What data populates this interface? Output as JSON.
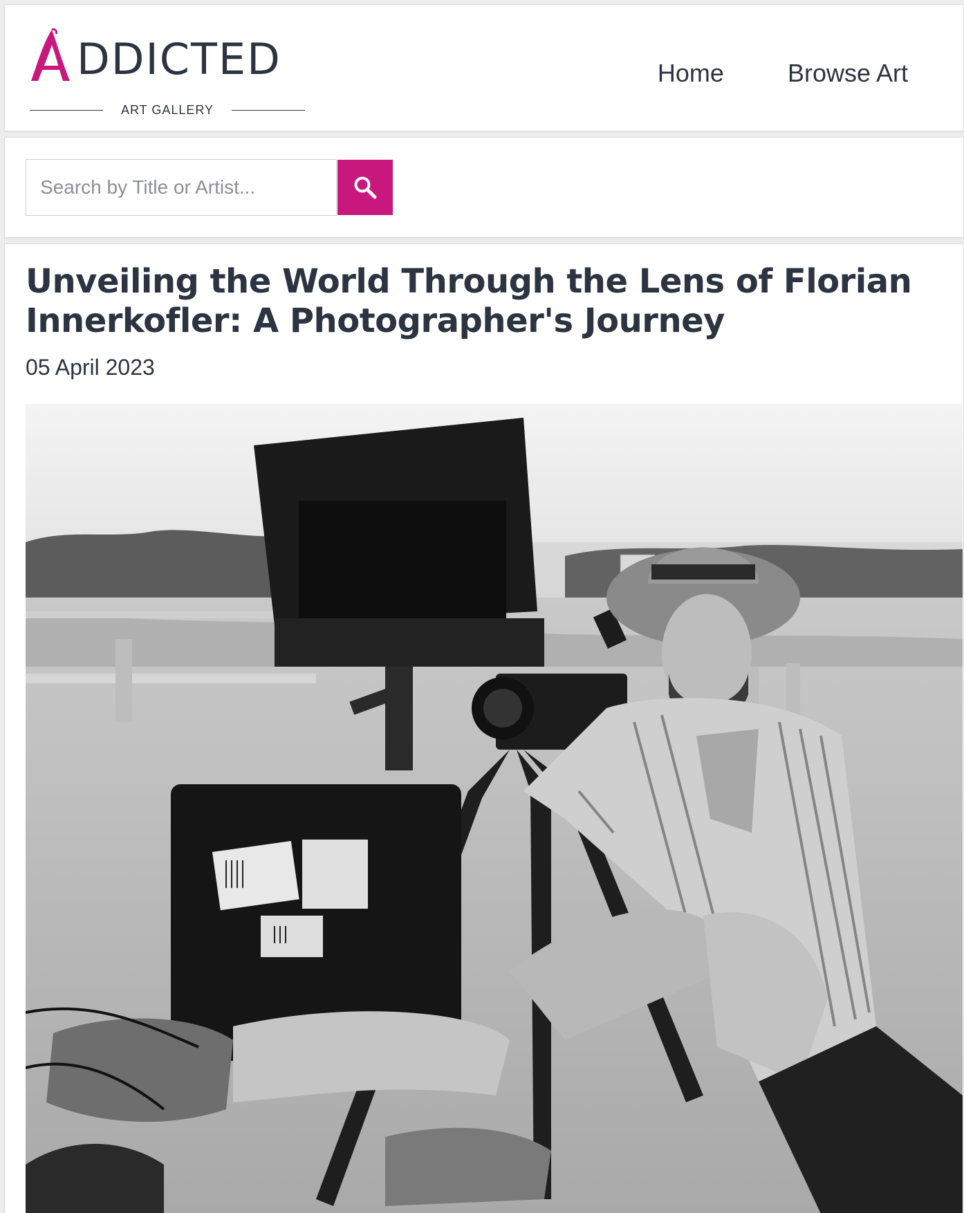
{
  "header": {
    "logo": {
      "wordmark": "ADDICTED",
      "subtitle": "ART GALLERY",
      "accent_color": "#c8187e"
    },
    "nav": [
      {
        "label": "Home"
      },
      {
        "label": "Browse Art"
      }
    ]
  },
  "search": {
    "placeholder": "Search by Title or Artist...",
    "value": "",
    "button_icon": "search-icon",
    "button_color": "#c8187e"
  },
  "article": {
    "title": "Unveiling the World Through the Lens of Florian Innerkofler: A Photographer's Journey",
    "date": "05 April 2023"
  }
}
